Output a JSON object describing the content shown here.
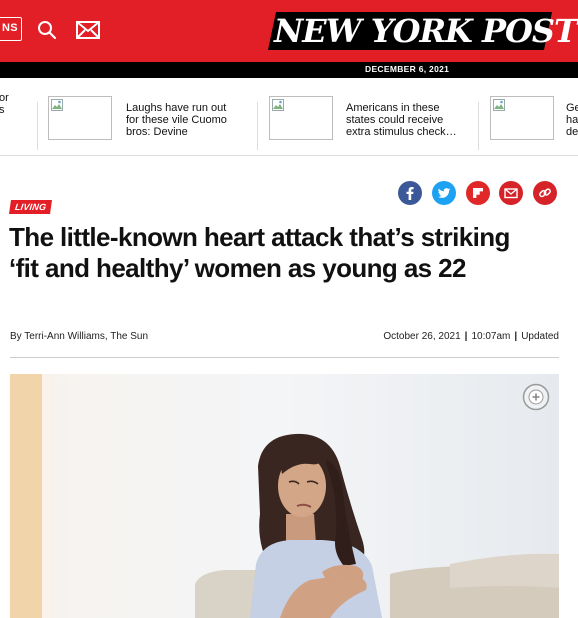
{
  "header": {
    "sections_label": "NS",
    "logo_text": "NEW YORK POST",
    "date": "DECEMBER 6, 2021",
    "colors": {
      "brand_red": "#e21f26",
      "black": "#000000"
    },
    "icons": [
      "search-icon",
      "mail-icon"
    ]
  },
  "trending": [
    {
      "text": "or\ns"
    },
    {
      "text": "Laughs have run out\nfor these vile Cuomo\nbros: Devine"
    },
    {
      "text": "Americans in these\nstates could receive\nextra stimulus check…"
    },
    {
      "text": "Ge\nha\nde"
    }
  ],
  "share_icons": [
    "facebook-icon",
    "twitter-icon",
    "flipboard-icon",
    "email-icon",
    "link-icon"
  ],
  "article": {
    "section_tag": "LIVING",
    "headline": "The little-known heart attack that’s striking ‘fit and healthy’ women as young as 22",
    "byline": "By Terri-Ann Williams, The Sun",
    "date": "October 26, 2021",
    "time": "10:07am",
    "updated_label": "Updated",
    "photo_icon": "zoom-in-icon"
  }
}
